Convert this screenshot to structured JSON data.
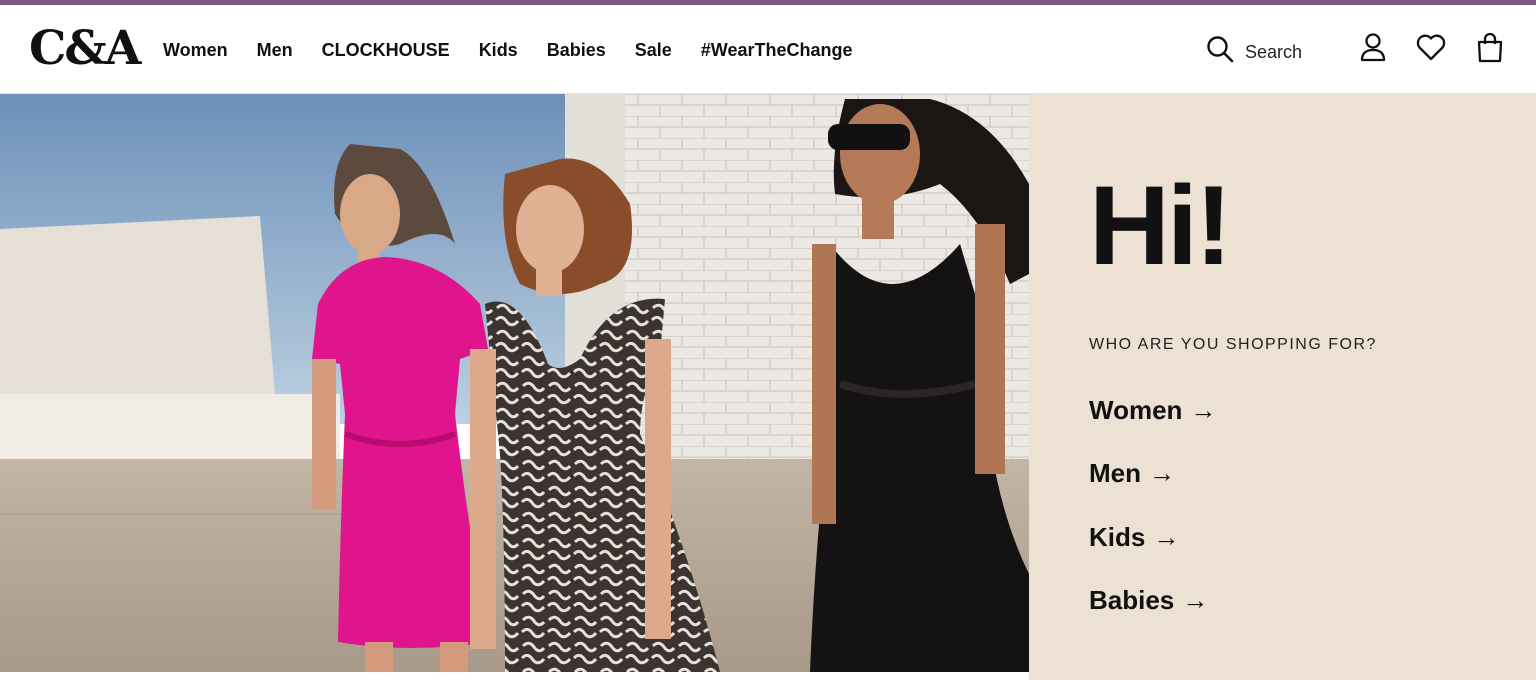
{
  "brand": {
    "logo_text": "C&A",
    "accent_color": "#7b5a7e"
  },
  "nav": {
    "items": [
      {
        "label": "Women"
      },
      {
        "label": "Men"
      },
      {
        "label": "CLOCKHOUSE"
      },
      {
        "label": "Kids"
      },
      {
        "label": "Babies"
      },
      {
        "label": "Sale"
      },
      {
        "label": "#WearTheChange"
      }
    ]
  },
  "header_actions": {
    "search_label": "Search",
    "search_icon": "search-icon",
    "account_icon": "user-icon",
    "wishlist_icon": "heart-icon",
    "bag_icon": "shopping-bag-icon"
  },
  "hero": {
    "panel_background": "#ece1d2",
    "greeting": "Hi!",
    "question": "WHO ARE YOU SHOPPING FOR?",
    "links": [
      {
        "label": "Women",
        "arrow": "→"
      },
      {
        "label": "Men",
        "arrow": "→"
      },
      {
        "label": "Kids",
        "arrow": "→"
      },
      {
        "label": "Babies",
        "arrow": "→"
      }
    ]
  }
}
